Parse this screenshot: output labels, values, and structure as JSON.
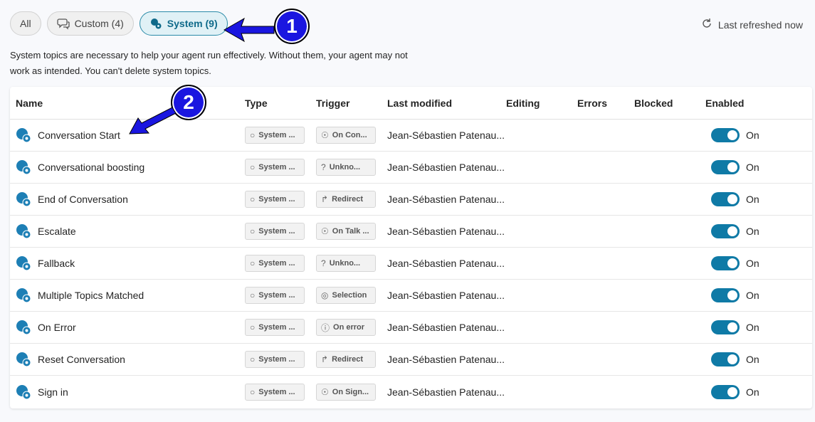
{
  "filters": {
    "all": "All",
    "custom": "Custom (4)",
    "system": "System (9)"
  },
  "refresh_label": "Last refreshed now",
  "description": "System topics are necessary to help your agent run effectively. Without them, your agent may not work as intended. You can't delete system topics.",
  "columns": {
    "name": "Name",
    "type": "Type",
    "trigger": "Trigger",
    "modified": "Last modified",
    "editing": "Editing",
    "errors": "Errors",
    "blocked": "Blocked",
    "enabled": "Enabled"
  },
  "rows": [
    {
      "name": "Conversation Start",
      "type": "System ...",
      "trigger": "On Con...",
      "trigger_icon": "lightbulb-icon",
      "modified": "Jean-Sébastien Patenau...",
      "enabled": "On"
    },
    {
      "name": "Conversational boosting",
      "type": "System ...",
      "trigger": "Unkno...",
      "trigger_icon": "question-icon",
      "modified": "Jean-Sébastien Patenau...",
      "enabled": "On"
    },
    {
      "name": "End of Conversation",
      "type": "System ...",
      "trigger": "Redirect",
      "trigger_icon": "redirect-icon",
      "modified": "Jean-Sébastien Patenau...",
      "enabled": "On"
    },
    {
      "name": "Escalate",
      "type": "System ...",
      "trigger": "On Talk ...",
      "trigger_icon": "lightbulb-icon",
      "modified": "Jean-Sébastien Patenau...",
      "enabled": "On"
    },
    {
      "name": "Fallback",
      "type": "System ...",
      "trigger": "Unkno...",
      "trigger_icon": "question-icon",
      "modified": "Jean-Sébastien Patenau...",
      "enabled": "On"
    },
    {
      "name": "Multiple Topics Matched",
      "type": "System ...",
      "trigger": "Selection",
      "trigger_icon": "selection-icon",
      "modified": "Jean-Sébastien Patenau...",
      "enabled": "On"
    },
    {
      "name": "On Error",
      "type": "System ...",
      "trigger": "On error",
      "trigger_icon": "error-icon",
      "modified": "Jean-Sébastien Patenau...",
      "enabled": "On"
    },
    {
      "name": "Reset Conversation",
      "type": "System ...",
      "trigger": "Redirect",
      "trigger_icon": "redirect-icon",
      "modified": "Jean-Sébastien Patenau...",
      "enabled": "On"
    },
    {
      "name": "Sign in",
      "type": "System ...",
      "trigger": "On Sign...",
      "trigger_icon": "lightbulb-icon",
      "modified": "Jean-Sébastien Patenau...",
      "enabled": "On"
    }
  ],
  "annotations": [
    "1",
    "2"
  ],
  "colors": {
    "accent": "#0f7aa6",
    "annotation": "#1a16e0"
  }
}
